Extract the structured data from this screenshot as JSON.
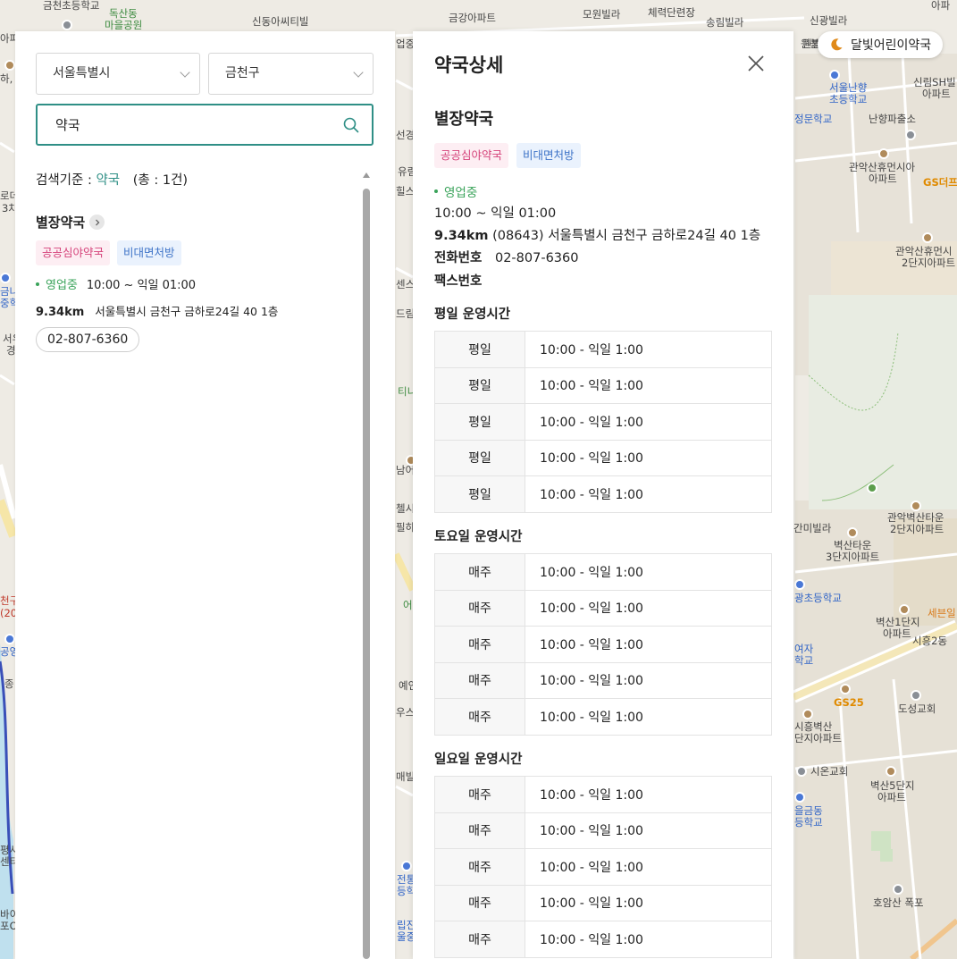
{
  "map": {
    "labels": [
      {
        "text": "금천초등학교",
        "style": ""
      },
      {
        "text": "독산동",
        "style": "green"
      },
      {
        "text": "마을공원",
        "style": "green"
      },
      {
        "text": "신동아씨티빌",
        "style": ""
      },
      {
        "text": "금강아파트",
        "style": ""
      },
      {
        "text": "모원빌라",
        "style": ""
      },
      {
        "text": "체력단련장",
        "style": ""
      },
      {
        "text": "송림빌라",
        "style": ""
      },
      {
        "text": "신광빌라",
        "style": ""
      },
      {
        "text": "원불",
        "style": ""
      },
      {
        "text": "서울난향",
        "style": "blue"
      },
      {
        "text": "초등학교",
        "style": "blue"
      },
      {
        "text": "정문학교",
        "style": "blue"
      },
      {
        "text": "난향파출소",
        "style": ""
      },
      {
        "text": "신림SH빌",
        "style": ""
      },
      {
        "text": "아파트",
        "style": ""
      },
      {
        "text": "관악산휴먼시아",
        "style": ""
      },
      {
        "text": "아파트",
        "style": ""
      },
      {
        "text": "GS더프",
        "style": "orange-b"
      },
      {
        "text": "관악산휴먼시",
        "style": ""
      },
      {
        "text": "2단지아파트",
        "style": ""
      },
      {
        "text": "관악벽산타운",
        "style": ""
      },
      {
        "text": "2단지아파트",
        "style": ""
      },
      {
        "text": "간미빌라",
        "style": ""
      },
      {
        "text": "벽산타운",
        "style": ""
      },
      {
        "text": "3단지아파트",
        "style": ""
      },
      {
        "text": "광초등학교",
        "style": "blue"
      },
      {
        "text": "세븐일",
        "style": "orange"
      },
      {
        "text": "벽산1단지",
        "style": ""
      },
      {
        "text": "아파트",
        "style": ""
      },
      {
        "text": "시흥2동",
        "style": ""
      },
      {
        "text": "여자",
        "style": "blue"
      },
      {
        "text": "학교",
        "style": "blue"
      },
      {
        "text": "GS25",
        "style": "orange-b"
      },
      {
        "text": "도성교회",
        "style": ""
      },
      {
        "text": "시흥벽산",
        "style": ""
      },
      {
        "text": "단지아파트",
        "style": ""
      },
      {
        "text": "시온교회",
        "style": ""
      },
      {
        "text": "벽산5단지",
        "style": ""
      },
      {
        "text": "아파트",
        "style": ""
      },
      {
        "text": "을금동",
        "style": "blue"
      },
      {
        "text": "등학교",
        "style": "blue"
      },
      {
        "text": "호암산 폭포",
        "style": ""
      },
      {
        "text": "업중",
        "style": ""
      },
      {
        "text": "선경",
        "style": ""
      },
      {
        "text": "유림",
        "style": ""
      },
      {
        "text": "힐스",
        "style": ""
      },
      {
        "text": "센스",
        "style": ""
      },
      {
        "text": "드림",
        "style": ""
      },
      {
        "text": "티니",
        "style": "green"
      },
      {
        "text": "남어",
        "style": ""
      },
      {
        "text": "첼시",
        "style": ""
      },
      {
        "text": "필하",
        "style": ""
      },
      {
        "text": "어",
        "style": "green"
      },
      {
        "text": "예인",
        "style": ""
      },
      {
        "text": "우스",
        "style": ""
      },
      {
        "text": "매빌라",
        "style": ""
      },
      {
        "text": "전통",
        "style": "blue"
      },
      {
        "text": "등학",
        "style": "blue"
      },
      {
        "text": "립진",
        "style": "blue"
      },
      {
        "text": "울중",
        "style": "blue"
      },
      {
        "text": "하,",
        "style": ""
      },
      {
        "text": "아파",
        "style": ""
      },
      {
        "text": "로데",
        "style": ""
      },
      {
        "text": "3차",
        "style": ""
      },
      {
        "text": "금나",
        "style": "blue"
      },
      {
        "text": "중학",
        "style": "blue"
      },
      {
        "text": "서우",
        "style": ""
      },
      {
        "text": "경",
        "style": ""
      },
      {
        "text": "천구",
        "style": "red"
      },
      {
        "text": "(20",
        "style": "red"
      },
      {
        "text": "공영",
        "style": "blue"
      },
      {
        "text": "종",
        "style": ""
      },
      {
        "text": "평사",
        "style": ""
      },
      {
        "text": "센터",
        "style": ""
      },
      {
        "text": "바이",
        "style": ""
      },
      {
        "text": "포O",
        "style": ""
      },
      {
        "text": "원빌라",
        "style": ""
      },
      {
        "text": "아파",
        "style": ""
      }
    ]
  },
  "search": {
    "city": "서울특별시",
    "district": "금천구",
    "query": "약국",
    "criteria_label": "검색기준 :",
    "criteria_keyword": "약국",
    "total": "(총 : 1건)"
  },
  "result": {
    "name": "별장약국",
    "tags": [
      "공공심야약국",
      "비대면처방"
    ],
    "status": "영업중",
    "hours": "10:00 ~ 익일 01:00",
    "distance": "9.34km",
    "address": "서울특별시 금천구 금하로24길 40 1층",
    "phone": "02-807-6360"
  },
  "detail": {
    "title": "약국상세",
    "name": "별장약국",
    "tags": [
      "공공심야약국",
      "비대면처방"
    ],
    "status": "영업중",
    "hours": "10:00 ~ 익일 01:00",
    "distance": "9.34km",
    "address": "(08643) 서울특별시 금천구 금하로24길 40 1층",
    "phone_label": "전화번호",
    "phone": "02-807-6360",
    "fax_label": "팩스번호",
    "fax": "",
    "weekday_title": "평일 운영시간",
    "saturday_title": "토요일 운영시간",
    "sunday_title": "일요일 운영시간",
    "weekday_rows": [
      {
        "day": "평일",
        "time": "10:00 - 익일 1:00"
      },
      {
        "day": "평일",
        "time": "10:00 - 익일 1:00"
      },
      {
        "day": "평일",
        "time": "10:00 - 익일 1:00"
      },
      {
        "day": "평일",
        "time": "10:00 - 익일 1:00"
      },
      {
        "day": "평일",
        "time": "10:00 - 익일 1:00"
      }
    ],
    "saturday_rows": [
      {
        "day": "매주",
        "time": "10:00 - 익일 1:00"
      },
      {
        "day": "매주",
        "time": "10:00 - 익일 1:00"
      },
      {
        "day": "매주",
        "time": "10:00 - 익일 1:00"
      },
      {
        "day": "매주",
        "time": "10:00 - 익일 1:00"
      },
      {
        "day": "매주",
        "time": "10:00 - 익일 1:00"
      }
    ],
    "sunday_rows": [
      {
        "day": "매주",
        "time": "10:00 - 익일 1:00"
      },
      {
        "day": "매주",
        "time": "10:00 - 익일 1:00"
      },
      {
        "day": "매주",
        "time": "10:00 - 익일 1:00"
      },
      {
        "day": "매주",
        "time": "10:00 - 익일 1:00"
      },
      {
        "day": "매주",
        "time": "10:00 - 익일 1:00"
      }
    ]
  },
  "night_button": {
    "label": "달빛어린이약국",
    "icon": "moon-icon",
    "icon_color": "#e08a1a"
  },
  "colors": {
    "accent": "#2f8f86",
    "open_status": "#3aa35a",
    "tag_pink": "#d5427a",
    "tag_blue": "#3f74c8"
  }
}
